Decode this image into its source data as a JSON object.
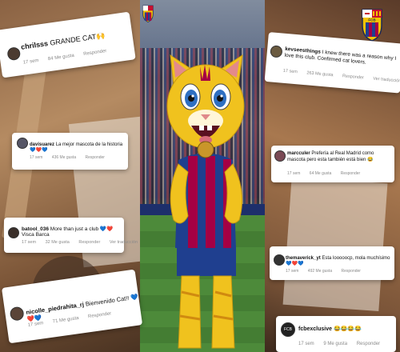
{
  "comments": [
    {
      "user": "chrilsss",
      "text": "GRANDE CAT🙌",
      "time": "17 sem",
      "likes": "84 Me gusta",
      "reply": "Responder",
      "translate": ""
    },
    {
      "user": "davisuarez",
      "text": "La mejor mascota de la historia 💙❤️💙",
      "time": "17 sem",
      "likes": "436 Me gusta",
      "reply": "Responder",
      "translate": ""
    },
    {
      "user": "batool_036",
      "text": "More than just a club 💙❤️Visca Barca",
      "time": "17 sem",
      "likes": "32 Me gusta",
      "reply": "Responder",
      "translate": "Ver traducción"
    },
    {
      "user": "nicolle_piedrahita_rj",
      "text": "Bienvenido Cat!! 💙❤️💙",
      "time": "17 sem",
      "likes": "71 Me gusta",
      "reply": "Responder",
      "translate": ""
    },
    {
      "user": "kevseesthings",
      "text": "I knew there was a reason why I love this club. Confirmed cat lovers.",
      "time": "17 sem",
      "likes": "263 Me gusta",
      "reply": "Responder",
      "translate": "Ver traducción"
    },
    {
      "user": "marcculer",
      "text": "Prefería al Real Madrid como mascota pero esta también está bien 😂",
      "time": "17 sem",
      "likes": "64 Me gusta",
      "reply": "Responder",
      "translate": ""
    },
    {
      "user": "themaverick_yt",
      "text": "Esta looooocp, mola muchísimo 💙❤️💙",
      "time": "17 sem",
      "likes": "492 Me gusta",
      "reply": "Responder",
      "translate": ""
    },
    {
      "user": "fcbexclusive",
      "text": "😂😂😂😂",
      "time": "17 sem",
      "likes": "9 Me gusta",
      "reply": "Responder",
      "translate": ""
    }
  ],
  "crest": {
    "letters": "FCB"
  },
  "colors": {
    "blaugrana_blue": "#1f3f8f",
    "blaugrana_red": "#a50044",
    "mascot_yellow": "#f0c21e"
  }
}
